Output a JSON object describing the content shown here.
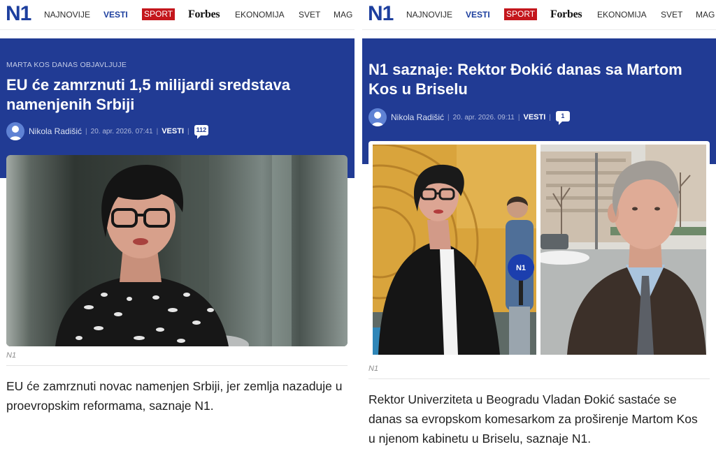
{
  "colors": {
    "brand_blue": "#213b94",
    "logo_blue": "#1d3f9e",
    "sport_red": "#c4161c",
    "text_dark": "#1f1f1f"
  },
  "icons": {
    "author_avatar": "user-icon",
    "comments": "comment-bubble-icon"
  },
  "left": {
    "nav": {
      "logo": "N1",
      "active_index": 1,
      "items": [
        {
          "label": "NAJNOVIJE"
        },
        {
          "label": "VESTI"
        },
        {
          "label": "SPORT"
        },
        {
          "label": "Forbes"
        },
        {
          "label": "EKONOMIJA"
        },
        {
          "label": "SVET"
        },
        {
          "label": "MAG"
        }
      ]
    },
    "article": {
      "kicker": "MARTA KOS DANAS OBJAVLJUJE",
      "title": "EU će zamrznuti 1,5 milijardi sredstava namenjenih Srbiji",
      "author": "Nikola Radišić",
      "separator": "|",
      "datetime": "20. apr. 2026. 07:41",
      "category": "VESTI",
      "comments": "112",
      "photo_credit": "N1",
      "lead": "EU će zamrznuti novac namenjen Srbiji, jer zemlja nazaduje u proevropskim reformama, saznaje N1."
    }
  },
  "right": {
    "nav": {
      "logo": "N1",
      "active_index": 1,
      "items": [
        {
          "label": "NAJNOVIJE"
        },
        {
          "label": "VESTI"
        },
        {
          "label": "SPORT"
        },
        {
          "label": "Forbes"
        },
        {
          "label": "EKONOMIJA"
        },
        {
          "label": "SVET"
        },
        {
          "label": "MAG"
        }
      ]
    },
    "article": {
      "title": "N1 saznaje: Rektor Đokić danas sa Martom Kos u Briselu",
      "author": "Nikola Radišić",
      "separator": "|",
      "datetime": "20. apr. 2026. 09:11",
      "category": "VESTI",
      "comments": "1",
      "photo": {
        "mic_label": "N1"
      },
      "photo_credit": "N1",
      "lead": "Rektor Univerziteta u Beogradu Vladan Đokić sastaće se danas sa evropskom komesarkom za proširenje Martom Kos u njenom kabinetu u Briselu, saznaje N1."
    }
  }
}
